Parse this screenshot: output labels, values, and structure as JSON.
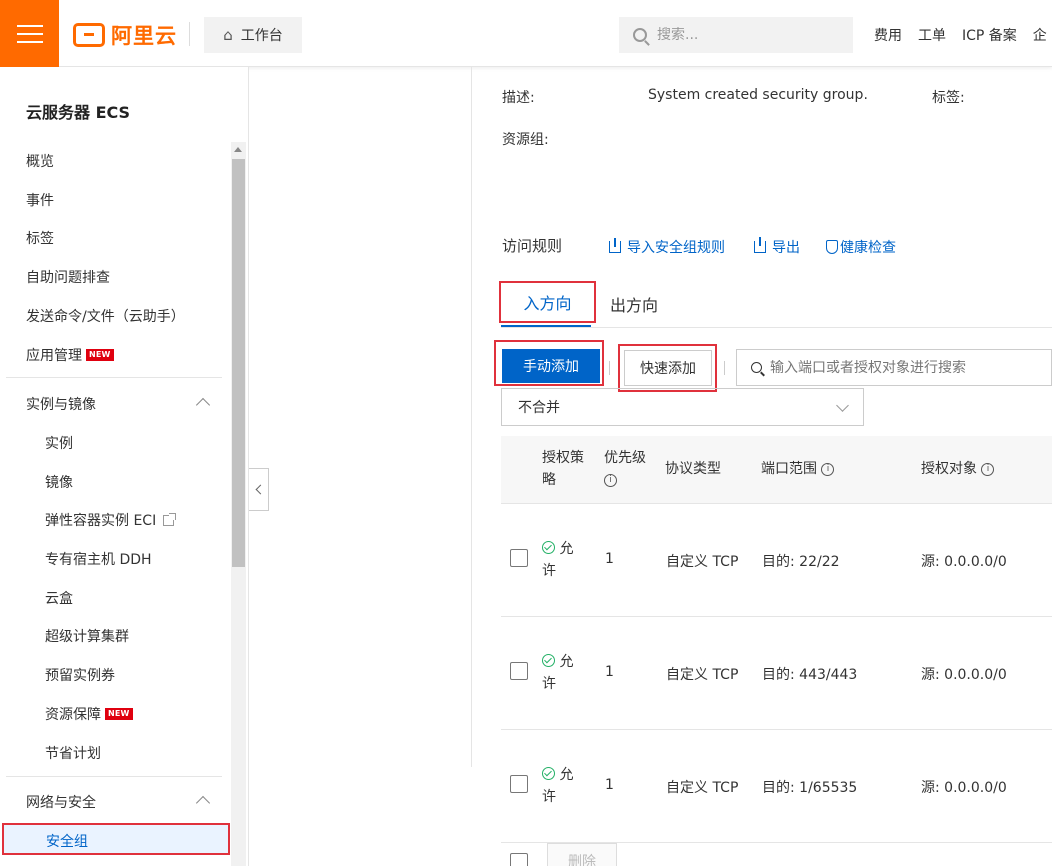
{
  "header": {
    "logo_text": "阿里云",
    "workbench_label": "工作台",
    "search_placeholder": "搜索...",
    "links": [
      "费用",
      "工单",
      "ICP 备案",
      "企"
    ]
  },
  "sidebar": {
    "title": "云服务器 ECS",
    "items": [
      "概览",
      "事件",
      "标签",
      "自助问题排查",
      "发送命令/文件（云助手）",
      "应用管理"
    ],
    "new_badge": "NEW",
    "group_instances": {
      "title": "实例与镜像",
      "items": [
        "实例",
        "镜像",
        "弹性容器实例 ECI",
        "专有宿主机 DDH",
        "云盒",
        "超级计算集群",
        "预留实例券",
        "资源保障",
        "节省计划"
      ]
    },
    "group_network": {
      "title": "网络与安全",
      "active_item": "安全组"
    }
  },
  "detail": {
    "desc_label": "描述:",
    "desc_value": "System created security group.",
    "tags_label": "标签:",
    "resource_group_label": "资源组:"
  },
  "rules": {
    "title": "访问规则",
    "import_link": "导入安全组规则",
    "export_link": "导出",
    "health_link": "健康检查",
    "tab_in": "入方向",
    "tab_out": "出方向",
    "btn_manual": "手动添加",
    "btn_quick": "快速添加",
    "search_placeholder": "输入端口或者授权对象进行搜索",
    "merge_value": "不合并",
    "columns": {
      "policy": "授权策略",
      "priority": "优先级",
      "protocol": "协议类型",
      "port": "端口范围",
      "target": "授权对象"
    },
    "rows": [
      {
        "policy": "允许",
        "priority": "1",
        "protocol": "自定义 TCP",
        "port": "目的: 22/22",
        "target": "源: 0.0.0.0/0"
      },
      {
        "policy": "允许",
        "priority": "1",
        "protocol": "自定义 TCP",
        "port": "目的: 443/443",
        "target": "源: 0.0.0.0/0"
      },
      {
        "policy": "允许",
        "priority": "1",
        "protocol": "自定义 TCP",
        "port": "目的: 1/65535",
        "target": "源: 0.0.0.0/0"
      }
    ],
    "delete_label": "删除"
  },
  "colors": {
    "brand": "#ff6a00",
    "primary": "#0064c8",
    "highlight": "#e0313c",
    "allow": "#23b066"
  }
}
